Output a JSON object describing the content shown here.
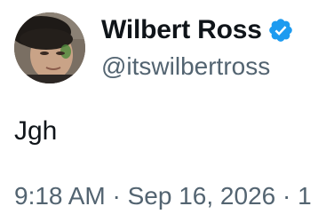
{
  "author": {
    "display_name": "Wilbert Ross",
    "handle": "@itswilbertross",
    "verified_icon": "verified-badge-icon",
    "verified_color": "#1d9bf0"
  },
  "tweet": {
    "text": "Jgh"
  },
  "meta": {
    "time": "9:18 AM",
    "separator": "·",
    "date": "Sep 16, 2026",
    "separator2": "·",
    "views_partial": "1"
  },
  "colors": {
    "primary_text": "#0f1419",
    "secondary_text": "#536471",
    "accent": "#1d9bf0"
  }
}
